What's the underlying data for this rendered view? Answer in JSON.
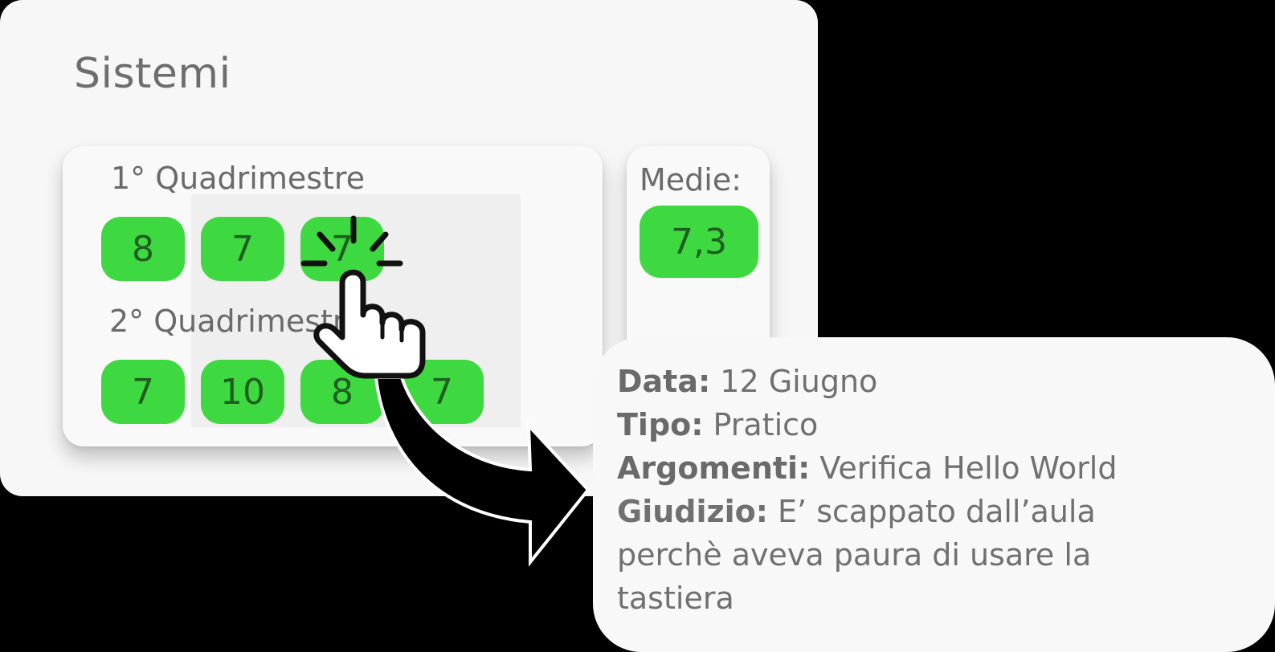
{
  "subject": {
    "title": "Sistemi"
  },
  "grades": {
    "term1": {
      "label": "1° Quadrimestre",
      "values": [
        "8",
        "7",
        "7"
      ]
    },
    "term2": {
      "label": "2° Quadrimestre",
      "values": [
        "7",
        "10",
        "8",
        "7"
      ]
    }
  },
  "averages": {
    "label": "Medie:",
    "value": "7,3"
  },
  "detail": {
    "date_label": "Data:",
    "date_value": "12 Giugno",
    "type_label": "Tipo:",
    "type_value": "Pratico",
    "topics_label": "Argomenti:",
    "topics_value": "Verifica Hello World",
    "judgement_label": "Giudizio:",
    "judgement_value": "E’ scappato dall’aula perchè aveva paura di usare la tastiera"
  },
  "icons": {
    "pointer": "hand-pointer-icon",
    "tap": "tap-burst-icon",
    "arrow": "curved-arrow-icon"
  },
  "colors": {
    "grade_chip": "#3ed940",
    "grade_text": "#1f5e20",
    "card_bg": "#f7f7f7",
    "text": "#6e6e6e"
  }
}
